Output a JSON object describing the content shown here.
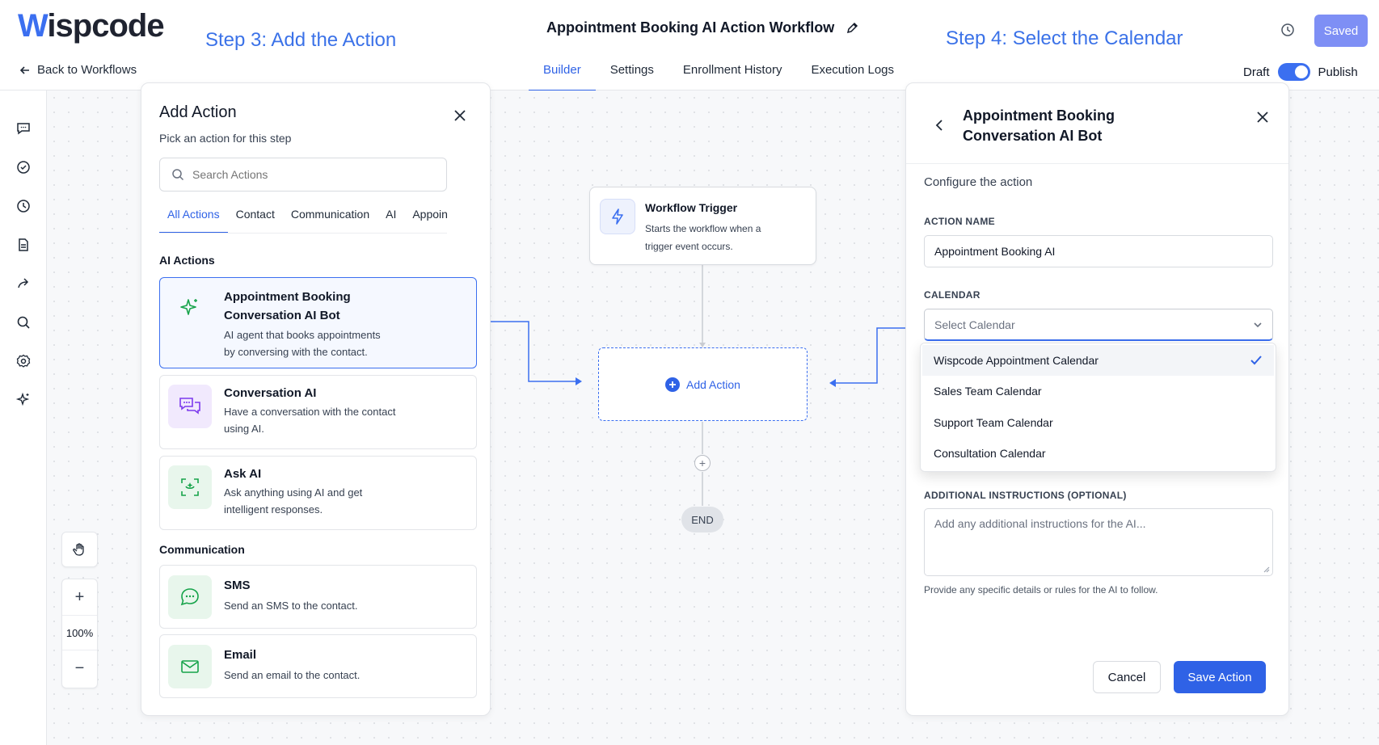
{
  "header": {
    "logo": {
      "mark": "W",
      "rest": "ispcode"
    },
    "back_link": "Back to Workflows",
    "step3": "Step 3: Add the Action",
    "step4": "Step 4: Select the Calendar",
    "workflow_title": "Appointment Booking AI Action Workflow",
    "tabs": [
      "Builder",
      "Settings",
      "Enrollment History",
      "Execution Logs"
    ],
    "active_tab": "Builder",
    "saved_label": "Saved",
    "draft_label": "Draft",
    "publish_label": "Publish"
  },
  "rail": {
    "icons": [
      "chat-icon",
      "check-circle-icon",
      "clock-icon",
      "document-icon",
      "share-icon",
      "search-icon",
      "settings-icon",
      "sparkle-icon"
    ]
  },
  "zoom": {
    "level": "100%",
    "plus": "+",
    "minus": "−"
  },
  "add_action": {
    "title": "Add Action",
    "subtitle": "Pick an action for this step",
    "search_placeholder": "Search Actions",
    "tabs": [
      "All Actions",
      "Contact",
      "Communication",
      "AI",
      "Appoin"
    ],
    "sections": {
      "ai": "AI Actions",
      "communication": "Communication"
    },
    "cards": [
      {
        "title_line1": "Appointment Booking",
        "title_line2": "Conversation AI Bot",
        "desc_line1": "AI agent that books appointments",
        "desc_line2": "by conversing with the contact."
      },
      {
        "title": "Conversation AI",
        "desc_line1": "Have a conversation with the contact",
        "desc_line2": "using AI."
      },
      {
        "title": "Ask AI",
        "desc_line1": "Ask anything using AI and get",
        "desc_line2": "intelligent responses."
      },
      {
        "title": "SMS",
        "desc_line1": "Send an SMS to the contact."
      },
      {
        "title": "Email",
        "desc_line1": "Send an email to the contact."
      }
    ]
  },
  "flow": {
    "trigger_title": "Workflow Trigger",
    "trigger_desc_line1": "Starts the workflow when a",
    "trigger_desc_line2": "trigger event occurs.",
    "add_action_label": "Add Action",
    "plus": "+",
    "end_label": "END"
  },
  "config": {
    "title_line1": "Appointment Booking",
    "title_line2": "Conversation AI Bot",
    "section_label": "Configure the action",
    "action_name_label": "ACTION NAME",
    "action_name_value": "Appointment Booking AI",
    "calendar_label": "CALENDAR",
    "calendar_placeholder": "Select Calendar",
    "calendar_options": [
      "Wispcode Appointment Calendar",
      "Sales Team Calendar",
      "Support Team Calendar",
      "Consultation Calendar"
    ],
    "selected_option": "Wispcode Appointment Calendar",
    "instructions_label": "ADDITIONAL INSTRUCTIONS (OPTIONAL)",
    "instructions_placeholder": "Add any additional instructions for the AI...",
    "instructions_help": "Provide any specific details or rules for the AI to follow.",
    "cancel_label": "Cancel",
    "save_label": "Save Action"
  },
  "colors": {
    "accent": "#2f62e6",
    "step_annotation": "#3b72e8",
    "saved_button": "#7e8ff5",
    "ai_icon_green": "#16a34a",
    "conversation_icon_bg": "#f1e9fd",
    "green_icon_bg": "#e8f6ec"
  }
}
